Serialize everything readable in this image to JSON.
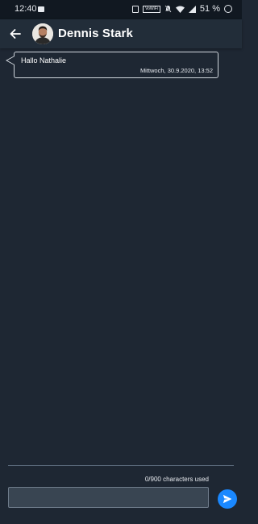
{
  "status_bar": {
    "time": "12:40",
    "volte_label": "VoWiFi",
    "battery": "51 %"
  },
  "header": {
    "contact_name": "Dennis Stark",
    "icons": [
      "back-arrow-icon",
      "avatar"
    ]
  },
  "messages": [
    {
      "text": "Hallo Nathalie",
      "timestamp": "Mittwoch, 30.9.2020, 13:52",
      "direction": "incoming"
    }
  ],
  "compose": {
    "char_counter": "0/900 characters used",
    "input_value": "",
    "send_icon": "send-icon"
  },
  "colors": {
    "background": "#1e2733",
    "app_bar": "#222d39",
    "accent": "#1a88ff",
    "bubble_border": "#cfd5dc"
  }
}
